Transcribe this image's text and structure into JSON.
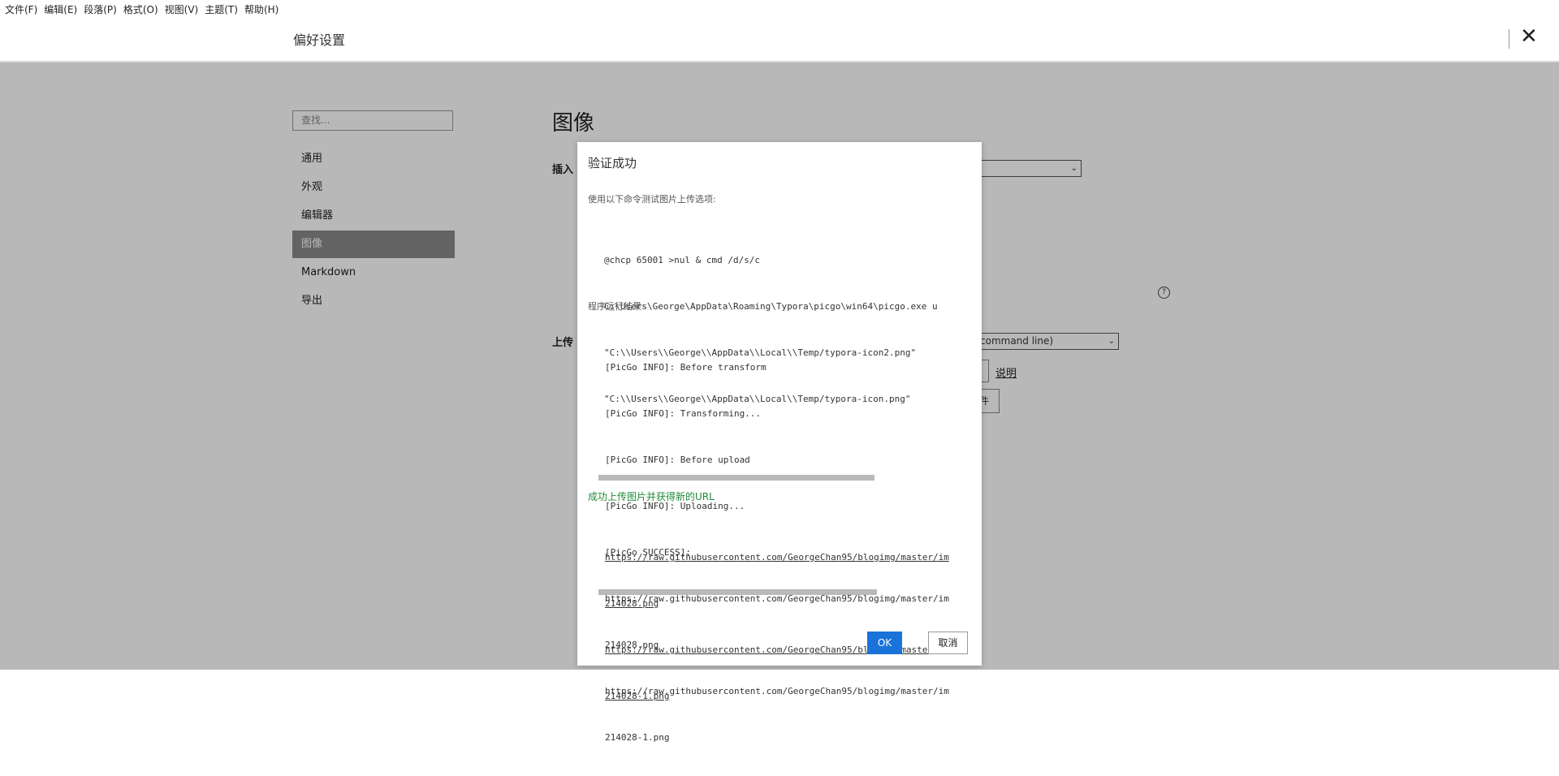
{
  "menubar": {
    "items": [
      "文件(F)",
      "编辑(E)",
      "段落(P)",
      "格式(O)",
      "视图(V)",
      "主题(T)",
      "帮助(H)"
    ]
  },
  "header": {
    "title": "偏好设置",
    "close_icon": "close-icon"
  },
  "sidebar": {
    "search_placeholder": "查找...",
    "items": [
      {
        "label": "通用"
      },
      {
        "label": "外观"
      },
      {
        "label": "编辑器"
      },
      {
        "label": "图像",
        "active": true
      },
      {
        "label": "Markdown"
      },
      {
        "label": "导出"
      }
    ]
  },
  "main": {
    "title": "图像",
    "insert_label": "插入",
    "upload_label": "上传",
    "upload_select_value": "command line)",
    "doc_link": "说明",
    "partial_button": "件",
    "help_icon": "question-circle-icon"
  },
  "dialog": {
    "title": "验证成功",
    "command_label": "使用以下命令测试图片上传选项:",
    "command_lines": [
      "@chcp 65001 >nul & cmd /d/s/c",
      "C:\\Users\\George\\AppData\\Roaming\\Typora\\picgo\\win64\\picgo.exe u",
      "\"C:\\\\Users\\\\George\\\\AppData\\\\Local\\\\Temp/typora-icon2.png\"",
      "\"C:\\\\Users\\\\George\\\\AppData\\\\Local\\\\Temp/typora-icon.png\""
    ],
    "result_label": "程序运行结果:",
    "result_lines": [
      "[PicGo INFO]: Before transform",
      "[PicGo INFO]: Transforming...",
      "[PicGo INFO]: Before upload",
      "[PicGo INFO]: Uploading...",
      "[PicGo SUCCESS]:",
      "https://raw.githubusercontent.com/GeorgeChan95/blogimg/master/im",
      "214028.png",
      "https://raw.githubusercontent.com/GeorgeChan95/blogimg/master/im",
      "214028-1.png"
    ],
    "success_text": "成功上传图片并获得新的URL",
    "url_lines": [
      "https://raw.githubusercontent.com/GeorgeChan95/blogimg/master/im",
      "214028.png",
      "https://raw.githubusercontent.com/GeorgeChan95/blogimg/master/im",
      "214028-1.png"
    ],
    "ok_label": "OK",
    "cancel_label": "取消"
  },
  "colors": {
    "accent": "#1a73d9",
    "success": "#1f8a3a",
    "active_nav": "#8a8a8a"
  }
}
